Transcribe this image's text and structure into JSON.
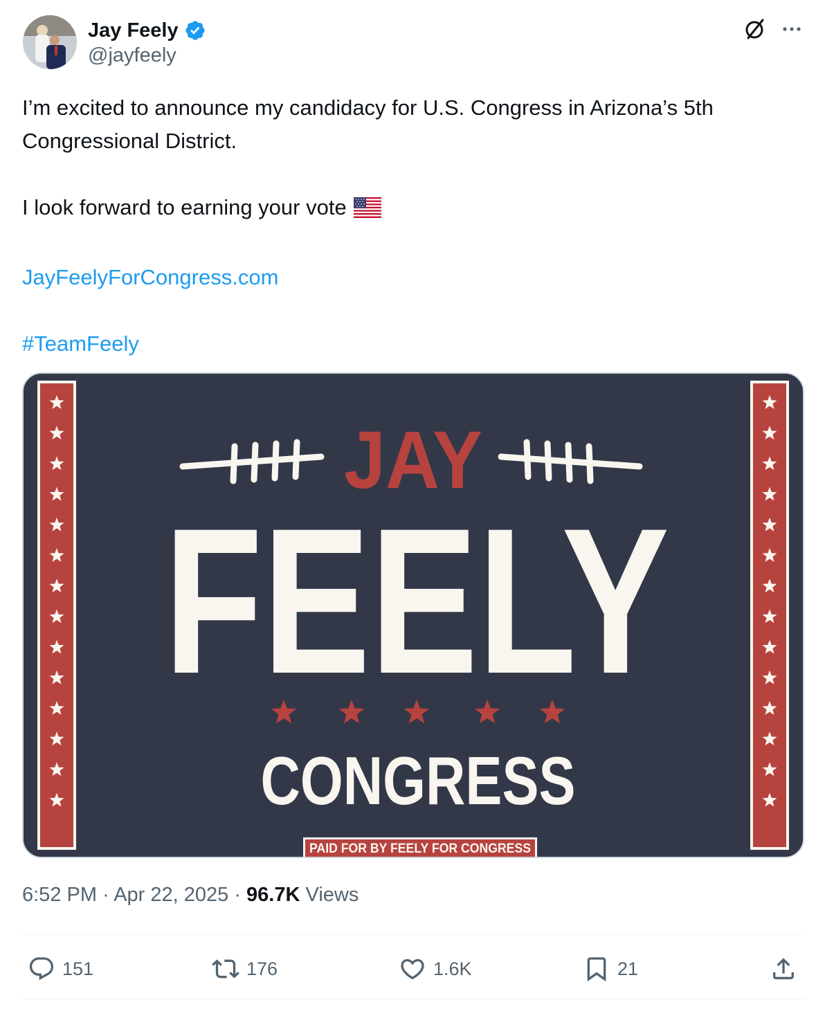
{
  "author": {
    "display_name": "Jay Feely",
    "handle": "@jayfeely"
  },
  "tweet": {
    "line1": "I’m excited to announce my candidacy for U.S. Congress in Arizona’s 5th Congressional District.",
    "line2": "I look forward to earning your vote",
    "flag_emoji": "us-flag-emoji",
    "link": "JayFeelyForCongress.com",
    "hashtag": "#TeamFeely"
  },
  "media": {
    "top_word": "JAY",
    "main_word": "FEELY",
    "bottom_word": "CONGRESS",
    "disclaimer": "PAID FOR BY FEELY FOR CONGRESS",
    "colors": {
      "background": "#333849",
      "red": "#b7433f",
      "cream": "#f8f6ef"
    }
  },
  "meta": {
    "time": "6:52 PM",
    "date": "Apr 22, 2025",
    "views_count": "96.7K",
    "views_label": "Views"
  },
  "actions": {
    "replies": "151",
    "reposts": "176",
    "likes": "1.6K",
    "bookmarks": "21"
  },
  "icons": [
    "verified-badge-icon",
    "grok-icon",
    "more-icon",
    "reply-icon",
    "repost-icon",
    "like-icon",
    "bookmark-icon",
    "share-icon"
  ],
  "accent_color": "#1d9bf0"
}
